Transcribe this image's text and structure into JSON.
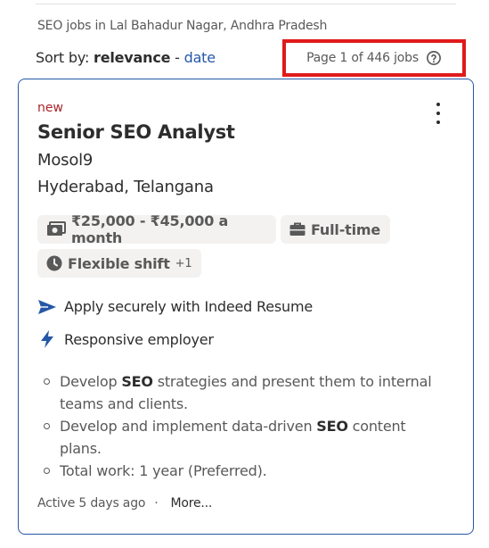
{
  "breadcrumb": "SEO jobs in Lal Bahadur Nagar, Andhra Pradesh",
  "sort": {
    "label": "Sort by:",
    "current": "relevance",
    "separator": "-",
    "alt_option": "date"
  },
  "pagination": {
    "text": "Page 1 of 446 jobs"
  },
  "job": {
    "badge": "new",
    "title": "Senior SEO Analyst",
    "company": "Mosol9",
    "location": "Hyderabad, Telangana",
    "chips": {
      "salary": "₹25,000 - ₹45,000 a month",
      "type": "Full-time",
      "shift": "Flexible shift",
      "shift_extra": "+1"
    },
    "features": {
      "apply": "Apply securely with Indeed Resume",
      "responsive": "Responsive employer"
    },
    "snippet": [
      {
        "pre": "Develop ",
        "bold": "SEO",
        "post": " strategies and present them to internal teams and clients."
      },
      {
        "pre": "Develop and implement data-driven ",
        "bold": "SEO",
        "post": " content plans."
      },
      {
        "pre": "Total work: 1 year (Preferred).",
        "bold": "",
        "post": ""
      }
    ],
    "footer": {
      "active": "Active 5 days ago",
      "separator": "·",
      "more": "More..."
    }
  },
  "colors": {
    "accent": "#2557a7",
    "new_badge": "#a9252b",
    "highlight_box": "#e01a1a"
  },
  "icons": {
    "help": "question-circle-icon",
    "menu": "kebab-menu-icon",
    "salary": "money-bill-icon",
    "type": "briefcase-icon",
    "shift": "clock-icon",
    "apply": "send-arrow-icon",
    "responsive": "lightning-bolt-icon"
  }
}
